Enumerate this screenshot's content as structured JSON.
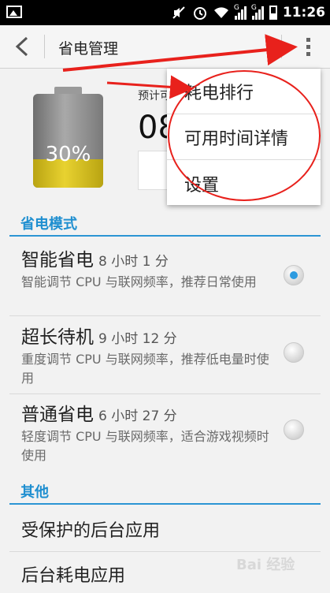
{
  "status_bar": {
    "time": "11:26",
    "network_1": "G",
    "network_2": "G",
    "icons": [
      "image-icon",
      "mute-icon",
      "alarm-icon",
      "wifi-icon",
      "signal-icon",
      "signal-icon",
      "battery-icon"
    ]
  },
  "action_bar": {
    "title": "省电管理",
    "back_icon": "chevron-left-icon",
    "overflow_icon": "overflow-menu-icon"
  },
  "battery": {
    "percent_label": "30%",
    "level": 0.3,
    "estimate_label": "预计可",
    "estimate_value": "08"
  },
  "sections": {
    "modes_title": "省电模式",
    "other_title": "其他"
  },
  "modes": [
    {
      "name": "智能省电",
      "duration": "8 小时 1 分",
      "description": "智能调节 CPU 与联网频率，推荐日常使用",
      "selected": true
    },
    {
      "name": "超长待机",
      "duration": "9 小时 12 分",
      "description": "重度调节 CPU 与联网频率，推荐低电量时使用",
      "selected": false
    },
    {
      "name": "普通省电",
      "duration": "6 小时 27 分",
      "description": "轻度调节 CPU 与联网频率，适合游戏视频时使用",
      "selected": false
    }
  ],
  "other_items": [
    "受保护的后台应用",
    "后台耗电应用"
  ],
  "popup_menu": {
    "items": [
      "耗电排行",
      "可用时间详情",
      "设置"
    ]
  },
  "annotation_color": "#e8211c",
  "accent_color": "#1f8fd0",
  "watermark": "Bai 经验"
}
